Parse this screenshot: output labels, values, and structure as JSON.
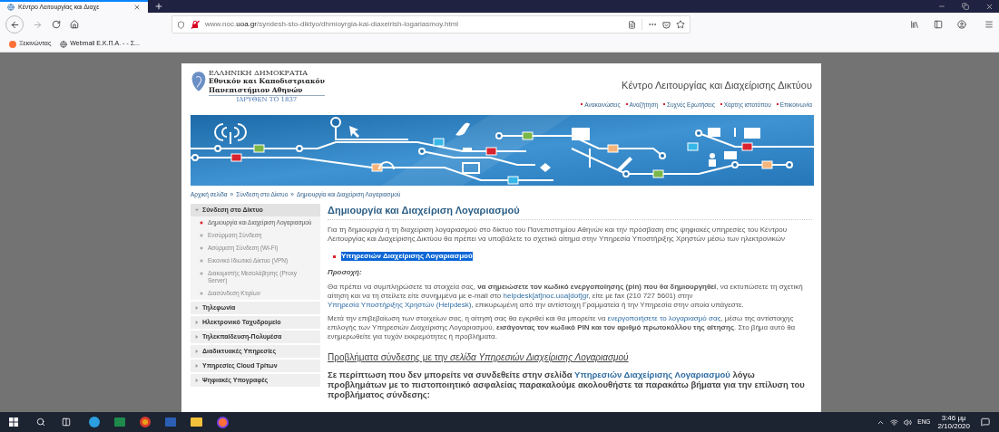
{
  "browser": {
    "tab_title": "Κέντρο Λειτουργίας και Διαχε",
    "url": "www.noc.**uoa.gr**/syndesh-sto-diktyo/dhmioyrgia-kai-diaxeirish-logariasmoy.html",
    "bookmarks": [
      "Ξεκινώντας",
      "Webmail Ε.Κ.Π.Α. - - Σ..."
    ]
  },
  "page": {
    "logo": {
      "country": "ΕΛΛΗΝΙΚΗ ΔΗΜΟΚΡΑΤΙΑ",
      "name_line_1": "Εθνικόν και Καποδιστριακόν",
      "name_line_2": "Πανεπιστήμιον Αθηνών",
      "founded": "ΙΔΡΥΘΕΝ ΤΟ 1837"
    },
    "site_title": "Κέντρο Λειτουργίας και Διαχείρισης Δικτύου",
    "top_links": [
      "Ανακοινώσεις",
      "Αναζήτηση",
      "Συχνές Ερωτήσεις",
      "Χάρτης ιστοτόπου",
      "Επικοινωνία"
    ],
    "breadcrumb": {
      "separator": "»",
      "items": [
        "Αρχική σελίδα",
        "Σύνδεση στο Δίκτυο",
        "Δημιουργία και Διαχείριση Λογαριασμού"
      ]
    },
    "sidebar": [
      {
        "label": "Σύνδεση στο Δίκτυο",
        "expanded": true,
        "children": [
          {
            "label": "Δημιουργία και Διαχείριση Λογαριασμού",
            "selected": true
          },
          {
            "label": "Ενσύρματη Σύνδεση",
            "selected": false
          },
          {
            "label": "Ασύρματη Σύνδεση (Wi-Fi)",
            "selected": false
          },
          {
            "label": "Εικονικό Ιδιωτικό Δίκτυο (VPN)",
            "selected": false
          },
          {
            "label": "Διακομιστής Μεσολάβησης (Proxy Server)",
            "selected": false
          },
          {
            "label": "Διασύνδεση Κτιρίων",
            "selected": false
          }
        ]
      },
      {
        "label": "Τηλεφωνία",
        "expanded": false
      },
      {
        "label": "Ηλεκτρονικό Ταχυδρομείο",
        "expanded": false
      },
      {
        "label": "Τηλεκπαίδευση-Πολυμέσα",
        "expanded": false
      },
      {
        "label": "Διαδικτυακές Υπηρεσίες",
        "expanded": false
      },
      {
        "label": "Υπηρεσίες Cloud Τρίτων",
        "expanded": false
      },
      {
        "label": "Ψηφιακές Υπογραφές",
        "expanded": false
      }
    ],
    "content": {
      "heading": "Δημιουργία και Διαχείριση Λογαριασμού",
      "intro": "Για τη δημιουργία ή τη διαχείριση λογαριασμού στο δίκτυο του Πανεπιστημίου Αθηνών και την πρόσβαση στις ψηφιακές υπηρεσίες του Κέντρου Λειτουργίας και Διαχείρισης Δικτύου θα πρέπει να υποβάλετε το σχετικό αίτημα στην Υπηρεσία Υποστήριξης Χρηστών μέσω των ηλεκτρονικών",
      "bullet": {
        "text": "Υπηρεσιών Διαχείρισης Λογαριασμού",
        "highlighted": true
      },
      "notice_label": "Προσοχή:",
      "paragraphs": [
        [
          {
            "kind": "text",
            "text": "Θα πρέπει να συμπληρώσετε τα στοιχεία σας, "
          },
          {
            "kind": "bold",
            "text": "να σημειώσετε τον κωδικό ενεργοποίησης (pin) που θα δημιουργηθεί"
          },
          {
            "kind": "text",
            "text": ", να εκτυπώσετε τη σχετική αίτηση και να τη στείλετε είτε συνημμένα με e-mail στο "
          },
          {
            "kind": "link",
            "text": "helpdesk[at]noc.uoa[dot]gr"
          },
          {
            "kind": "text",
            "text": ", είτε με fax (210 727 5601) στην "
          },
          {
            "kind": "link",
            "text": "Υπηρεσία Υποστήριξης Χρηστών (Helpdesk)"
          },
          {
            "kind": "text",
            "text": ", επικυρωμένη από την αντίστοιχη Γραμματεία ή την Υπηρεσία στην οποία υπάγεστε."
          }
        ],
        [
          {
            "kind": "text",
            "text": "Μετά την επιβεβαίωση των στοιχείων σας, η αίτησή σας θα εγκριθεί και θα μπορείτε να "
          },
          {
            "kind": "link",
            "text": "ενεργοποιήσετε το λογαριασμό σας"
          },
          {
            "kind": "text",
            "text": ", μέσω της αντίστοιχης επιλογής των Υπηρεσιών Διαχείρισης Λογαριασμού, "
          },
          {
            "kind": "bold",
            "text": "εισάγοντας τον κωδικό PIN και τον αριθμό πρωτοκόλλου της αίτησης"
          },
          {
            "kind": "text",
            "text": ". Στο βήμα αυτό θα ενημερωθείτε για τυχόν εκκρεμότητες ή προβλήματα."
          }
        ]
      ],
      "subheading": "Προβλήματα σύνδεσης με την *σελίδα Υπηρεσιών Διαχείρισης Λογαριασμού*",
      "closing": [
        {
          "kind": "text",
          "text": "Σε περίπτωση που δεν μπορείτε να συνδεθείτε στην σελίδα "
        },
        {
          "kind": "link",
          "text": "Υπηρεσιών Διαχείρισης Λογαριασμού"
        },
        {
          "kind": "text",
          "text": " λόγω προβλημάτων με το πιστοποιητικό ασφαλείας παρακαλούμε ακολουθήστε τα παρακάτω βήματα για την επίλυση του προβλήματος σύνδεσης:"
        }
      ]
    }
  },
  "taskbar": {
    "language": "ENG",
    "time": "3:46 μμ",
    "date": "2/10/2020"
  }
}
